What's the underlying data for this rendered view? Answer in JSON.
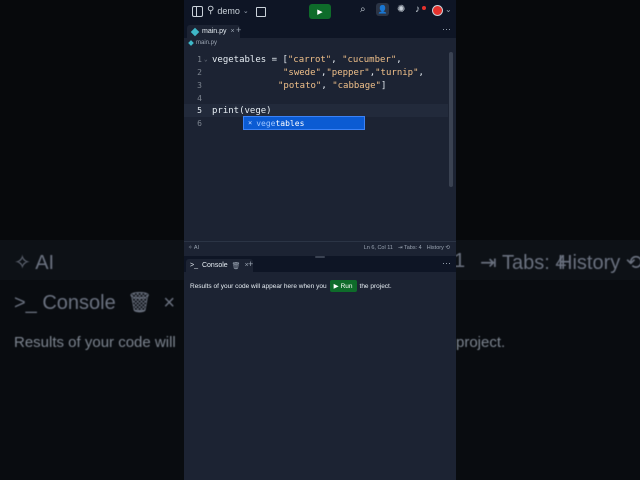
{
  "background_echo": {
    "ai": "AI",
    "tabs": "Tabs: 4",
    "history": "History",
    "line_num": "1",
    "console": "Console",
    "message_left": "Results of your code will",
    "message_right": "project."
  },
  "topbar": {
    "project_name": "demo",
    "run_symbol": "▶",
    "avatar_color": "#e5322d",
    "run_color": "#0e6b2a"
  },
  "tabs": [
    {
      "label": "main.py",
      "close": "×"
    }
  ],
  "tab_add": "+",
  "more": "⋯",
  "breadcrumb": {
    "file": "main.py"
  },
  "editor": {
    "lines": [
      {
        "num": "1"
      },
      {
        "num": "2"
      },
      {
        "num": "3"
      },
      {
        "num": "4"
      },
      {
        "num": "5"
      },
      {
        "num": "6"
      }
    ],
    "code": {
      "l1_a": "vegetables = [",
      "l1_s1": "\"carrot\"",
      "l1_b": ", ",
      "l1_s2": "\"cucumber\"",
      "l1_c": ",",
      "l2_s1": "\"swede\"",
      "l2_a": ",",
      "l2_s2": "\"pepper\"",
      "l2_b": ",",
      "l2_s3": "\"turnip\"",
      "l2_c": ",",
      "l3_s1": "\"potato\"",
      "l3_a": ", ",
      "l3_s2": "\"cabbage\"",
      "l3_b": "]",
      "l5": "print(vege)"
    },
    "autocomplete": {
      "icon": "×",
      "match": "vege",
      "rest": "tables"
    }
  },
  "statusbar": {
    "ai": "AI",
    "position": "Ln 6, Col 11",
    "tabs": "Tabs: 4",
    "history": "History"
  },
  "console": {
    "tab_label": "Console",
    "close": "×",
    "add": "+",
    "message_before": "Results of your code will appear here when you",
    "run_label": "Run",
    "message_after": "the project."
  }
}
